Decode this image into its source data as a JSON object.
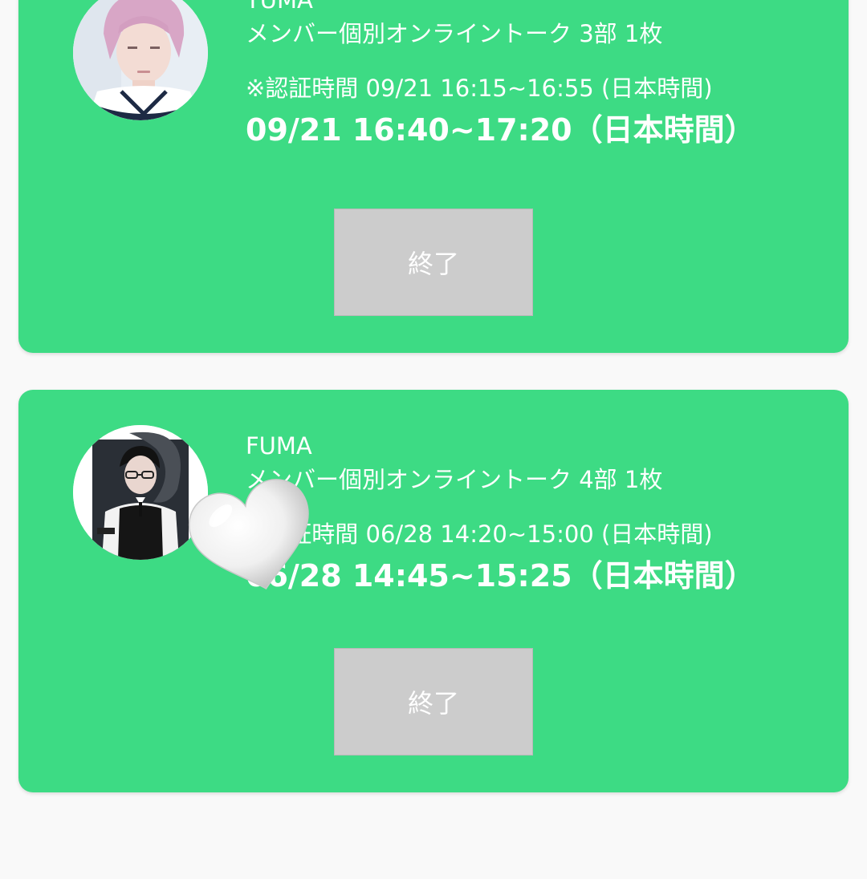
{
  "events": [
    {
      "member": "YUMA",
      "ticket": "メンバー個別オンライントーク  3部 1枚",
      "auth_time": "※認証時間 09/21 16:15~16:55 (日本時間)",
      "talk_time": "09/21 16:40~17:20（日本時間）",
      "status_label": "終了"
    },
    {
      "member": "FUMA",
      "ticket": "メンバー個別オンライントーク  4部 1枚",
      "auth_time": "※認証時間 06/28 14:20~15:00 (日本時間)",
      "talk_time": "06/28 14:45~15:25（日本時間）",
      "status_label": "終了"
    }
  ],
  "colors": {
    "card_background": "#3ddb84",
    "page_background": "#f9f9f9",
    "button_background": "#cccccc",
    "text": "#ffffff"
  },
  "icons": {
    "sticker": "white-heart-icon"
  }
}
